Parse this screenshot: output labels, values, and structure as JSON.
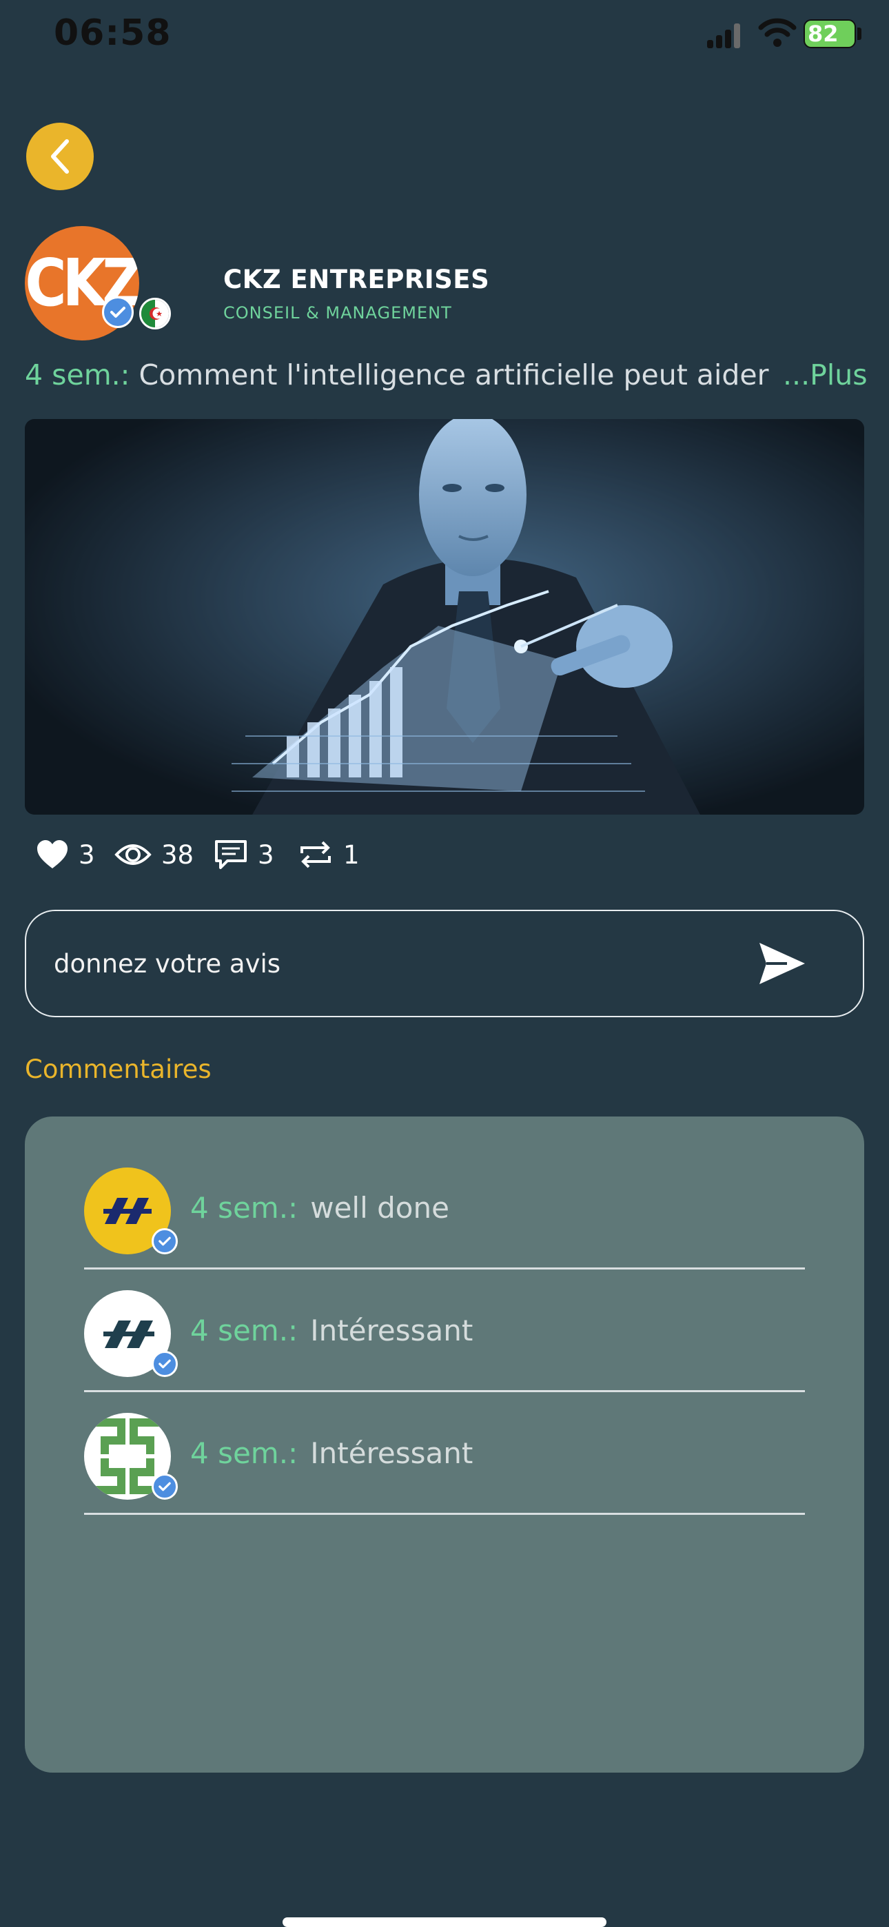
{
  "status_bar": {
    "time": "06:58",
    "battery": "82"
  },
  "profile": {
    "avatar_text": "CKZ",
    "name": "CKZ ENTREPRISES",
    "tagline": "CONSEIL & MANAGEMENT"
  },
  "post": {
    "time": "4 sem.:",
    "text": "Comment l'intelligence artificielle peut aider",
    "more_label": "...Plus"
  },
  "stats": {
    "likes": "3",
    "views": "38",
    "comments": "3",
    "reposts": "1"
  },
  "comment_input": {
    "placeholder": "donnez votre avis"
  },
  "comments_section": {
    "title": "Commentaires",
    "items": [
      {
        "time": "4 sem.:",
        "text": "well done"
      },
      {
        "time": "4 sem.:",
        "text": "Intéressant"
      },
      {
        "time": "4 sem.:",
        "text": "Intéressant"
      }
    ]
  },
  "colors": {
    "background": "#243844",
    "accent_yellow": "#eab52b",
    "accent_green": "#6fd39c",
    "panel": "#5f7878"
  }
}
